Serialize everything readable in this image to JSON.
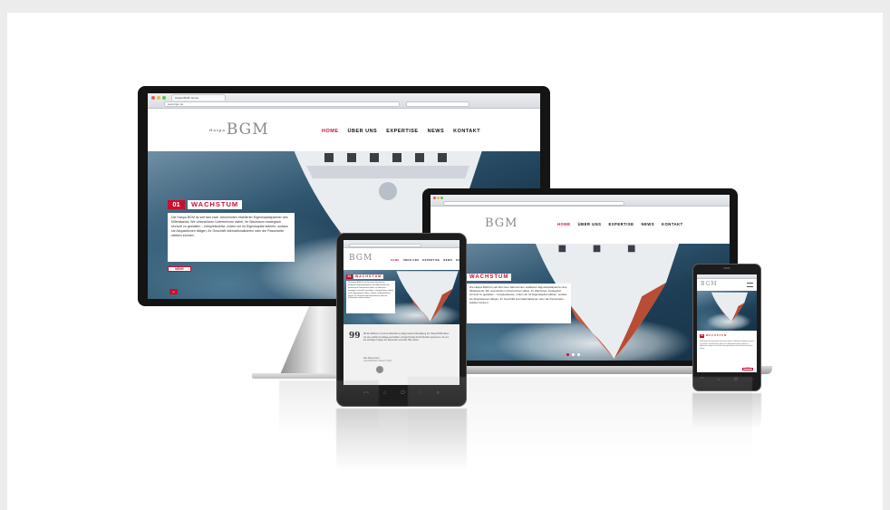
{
  "browser": {
    "tab_title": "Haspa BGM: Home",
    "url": "www.bgm.de"
  },
  "site": {
    "logo_prefix": "Haspa",
    "logo_main": "BGM",
    "nav": [
      "HOME",
      "ÜBER UNS",
      "EXPERTISE",
      "NEWS",
      "KONTAKT"
    ],
    "slide_number": "01",
    "slide_heading": "WACHSTUM",
    "slide_text": "Die Haspa BGM ist seit fast zwei Jahrzehnten etablierter Eigenkapitalpartner des Mittelstands. Wir unterstützen Unternehmer dabei, ihr Wachstum strategisch sinnvoll zu gestalten – beispielsweise, indem wir ihr Eigenkapital stärken, sodass sie Akquisitionen tätigen, ihr Geschäft internationalisieren oder die Passivseite stärken können.",
    "more_label": "MEHR"
  },
  "tablet": {
    "quote_mark": "99",
    "quote_text": "Mit der Effizienz und einer Waschkurve abgerundeten Beteiligung der Haspa BGM haben wir eine stabile Grundlage geschaffen und gleichzeitig Kontrollinstanz gewonnen, die uns bei wichtigen Fragen der Expansion wertvolle Hilfe leistet.",
    "quote_author": "Max Mustermann",
    "quote_role": "Geschäftsführer Muster GmbH"
  },
  "colors": {
    "brand_red": "#c8102e",
    "sea_dark": "#1e3e55",
    "bezel": "#141414"
  }
}
